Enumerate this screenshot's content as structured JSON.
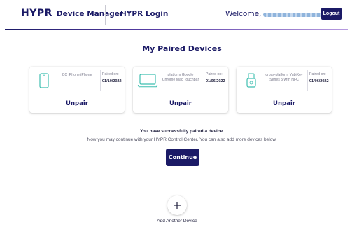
{
  "header": {
    "logo": "HYPR",
    "app_name": "Device Manager",
    "login_link": "HYPR Login",
    "welcome": "Welcome,",
    "logout_label": "Logout"
  },
  "main": {
    "title": "My Paired Devices",
    "devices": [
      {
        "icon": "smartphone-icon",
        "name": "CC iPhone iPhone",
        "paired_label": "Paired on:",
        "paired_date": "01/10/2022",
        "unpair_label": "Unpair"
      },
      {
        "icon": "laptop-icon",
        "name": "platform Google Chrome Mac Touchbar",
        "paired_label": "Paired on:",
        "paired_date": "01/06/2022",
        "unpair_label": "Unpair"
      },
      {
        "icon": "security-key-icon",
        "name": "cross-platform YubiKey Series 5 with NFC",
        "paired_label": "Paired on:",
        "paired_date": "01/06/2022",
        "unpair_label": "Unpair"
      }
    ],
    "success_message": "You have successfully paired a device.",
    "info_message": "Now you may continue with your HYPR Control Center. You can also add more devices below.",
    "continue_label": "Continue",
    "add_device_label": "Add Another Device"
  },
  "colors": {
    "brand_navy": "#1b1a66",
    "accent_teal": "#3fbfb0",
    "text_dark": "#1c1c3a",
    "text_muted": "#7a7a8c"
  }
}
